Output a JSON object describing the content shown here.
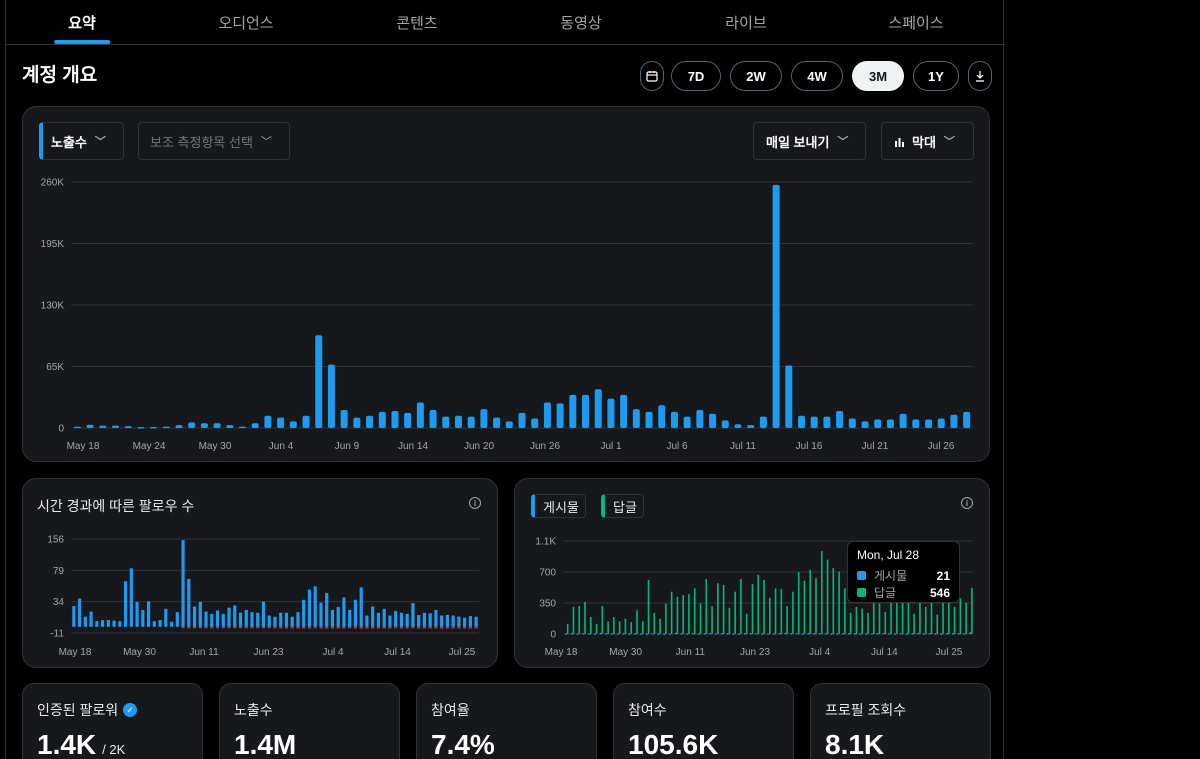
{
  "tabs": [
    {
      "label": "요약",
      "active": true
    },
    {
      "label": "오디언스",
      "active": false
    },
    {
      "label": "콘텐츠",
      "active": false
    },
    {
      "label": "동영상",
      "active": false
    },
    {
      "label": "라이브",
      "active": false
    },
    {
      "label": "스페이스",
      "active": false
    }
  ],
  "page_title": "계정 개요",
  "ranges": [
    {
      "label": "7D",
      "active": false
    },
    {
      "label": "2W",
      "active": false
    },
    {
      "label": "4W",
      "active": false
    },
    {
      "label": "3M",
      "active": true
    },
    {
      "label": "1Y",
      "active": false
    }
  ],
  "icons": {
    "calendar": "calendar-icon",
    "download": "download-icon",
    "bar_chart": "bar-chart-icon",
    "info": "info-icon",
    "verified": "verified-badge-icon"
  },
  "colors": {
    "accent": "#1d9bf0",
    "reply": "#00ba7c",
    "negative": "#f4212e"
  },
  "main_chart": {
    "metric": "노출수",
    "secondary_placeholder": "보조 측정항목 선택",
    "export": "매일 보내기",
    "chart_type": "막대"
  },
  "followers_chart_title": "시간 경과에 따른 팔로우 수",
  "posts_chart_legend": [
    "게시물",
    "답글"
  ],
  "tooltip": {
    "date": "Mon, Jul 28",
    "rows": [
      {
        "label": "게시물",
        "value": "21"
      },
      {
        "label": "답글",
        "value": "546"
      }
    ]
  },
  "stats": [
    {
      "label": "인증된 팔로워",
      "value": "1.4K",
      "sub": "/ 2K",
      "verified": true
    },
    {
      "label": "노출수",
      "value": "1.4M"
    },
    {
      "label": "참여율",
      "value": "7.4%"
    },
    {
      "label": "참여수",
      "value": "105.6K"
    },
    {
      "label": "프로필 조회수",
      "value": "8.1K"
    }
  ],
  "chart_data": [
    {
      "type": "bar",
      "series": [
        {
          "name": "노출수",
          "values": [
            1500,
            3500,
            2500,
            2500,
            2000,
            1000,
            1000,
            1500,
            3000,
            6000,
            5000,
            5000,
            3000,
            1500,
            5000,
            13000,
            11000,
            7000,
            13000,
            98000,
            67000,
            19000,
            11000,
            13000,
            17000,
            18000,
            16000,
            27000,
            19000,
            12000,
            13000,
            12000,
            20000,
            11000,
            7000,
            16000,
            10000,
            27000,
            26000,
            35000,
            35000,
            41000,
            31000,
            35000,
            20000,
            17000,
            24000,
            17000,
            12000,
            19000,
            15000,
            8000,
            4000,
            3000,
            12000,
            257000,
            66000,
            13000,
            12000,
            12000,
            18000,
            10000,
            7000,
            9000,
            9000,
            15000,
            9000,
            9000,
            10000,
            14000,
            17000
          ]
        }
      ],
      "ylim": [
        0,
        260000
      ],
      "yticks": [
        "0",
        "65K",
        "130K",
        "195K",
        "260K"
      ],
      "xticks": [
        "May 18",
        "May 24",
        "May 30",
        "Jun 4",
        "Jun 9",
        "Jun 14",
        "Jun 20",
        "Jun 26",
        "Jul 1",
        "Jul 6",
        "Jul 11",
        "Jul 16",
        "Jul 21",
        "Jul 26"
      ],
      "grid": true
    },
    {
      "type": "bar",
      "title": "시간 경과에 따른 팔로우 수",
      "series": [
        {
          "values": [
            37,
            50,
            18,
            27,
            10,
            12,
            12,
            11,
            10,
            81,
            104,
            44,
            30,
            45,
            10,
            12,
            32,
            9,
            26,
            154,
            85,
            36,
            44,
            27,
            23,
            29,
            23,
            34,
            38,
            25,
            30,
            26,
            25,
            45,
            20,
            18,
            25,
            25,
            18,
            26,
            48,
            66,
            72,
            43,
            60,
            30,
            35,
            52,
            30,
            48,
            70,
            20,
            36,
            25,
            32,
            20,
            28,
            25,
            23,
            42,
            21,
            25,
            24,
            30,
            20,
            21,
            20,
            18,
            16,
            19,
            18
          ]
        },
        {
          "values": [
            0,
            0,
            0,
            0,
            0,
            0,
            0,
            0,
            0,
            0,
            0,
            0,
            0,
            0,
            0,
            0,
            0,
            0,
            0,
            -1,
            -1,
            -1,
            -1,
            -1,
            -1,
            -1,
            -1,
            -1,
            -1,
            -1,
            -1,
            -1,
            -1,
            -1,
            -2,
            -2,
            -3,
            -3,
            -2,
            -3,
            -3,
            -3,
            -2,
            -3,
            -3,
            -3,
            -3,
            -3,
            -2,
            -3,
            -3,
            -3,
            -3,
            -3,
            -2,
            -3,
            -2,
            -3,
            -3,
            -2,
            -3,
            -3,
            -3,
            -3,
            -3,
            -3,
            -3,
            -3,
            -3,
            -3,
            -3
          ]
        }
      ],
      "ylim": [
        -11,
        156
      ],
      "yticks": [
        "-11",
        "34",
        "79",
        "156"
      ],
      "xticks": [
        "May 18",
        "May 30",
        "Jun 11",
        "Jun 23",
        "Jul 4",
        "Jul 14",
        "Jul 25"
      ],
      "grid": true
    },
    {
      "type": "bar",
      "series": [
        {
          "name": "게시물",
          "values": [
            8,
            10,
            6,
            12,
            8,
            6,
            14,
            9,
            10,
            7,
            12,
            8,
            10,
            6,
            9,
            11,
            8,
            6,
            8,
            14,
            10,
            9,
            11,
            10,
            7,
            12,
            9,
            11,
            10,
            8,
            6,
            9,
            12,
            11,
            10,
            8,
            9,
            11,
            13,
            12,
            10,
            8,
            11,
            9,
            12,
            10,
            8,
            9,
            11,
            10,
            12,
            9,
            10,
            8,
            11,
            12,
            10,
            9,
            11,
            8,
            10,
            12,
            9,
            11,
            10,
            8,
            12,
            9,
            11,
            10,
            21
          ]
        },
        {
          "name": "답글",
          "values": [
            120,
            320,
            330,
            380,
            200,
            120,
            330,
            150,
            200,
            150,
            180,
            140,
            280,
            150,
            640,
            250,
            180,
            360,
            500,
            440,
            460,
            470,
            540,
            360,
            650,
            330,
            600,
            580,
            310,
            500,
            650,
            240,
            590,
            700,
            640,
            430,
            540,
            530,
            330,
            500,
            730,
            630,
            760,
            660,
            980,
            880,
            780,
            740,
            540,
            250,
            320,
            300,
            250,
            460,
            360,
            260,
            460,
            460,
            460,
            370,
            240,
            380,
            320,
            420,
            230,
            390,
            460,
            320,
            420,
            370,
            546
          ]
        }
      ],
      "ylim": [
        0,
        1100
      ],
      "yticks": [
        "0",
        "350",
        "700",
        "1.1K"
      ],
      "xticks": [
        "May 18",
        "May 30",
        "Jun 11",
        "Jun 23",
        "Jul 4",
        "Jul 14",
        "Jul 25"
      ],
      "grid": true
    }
  ]
}
